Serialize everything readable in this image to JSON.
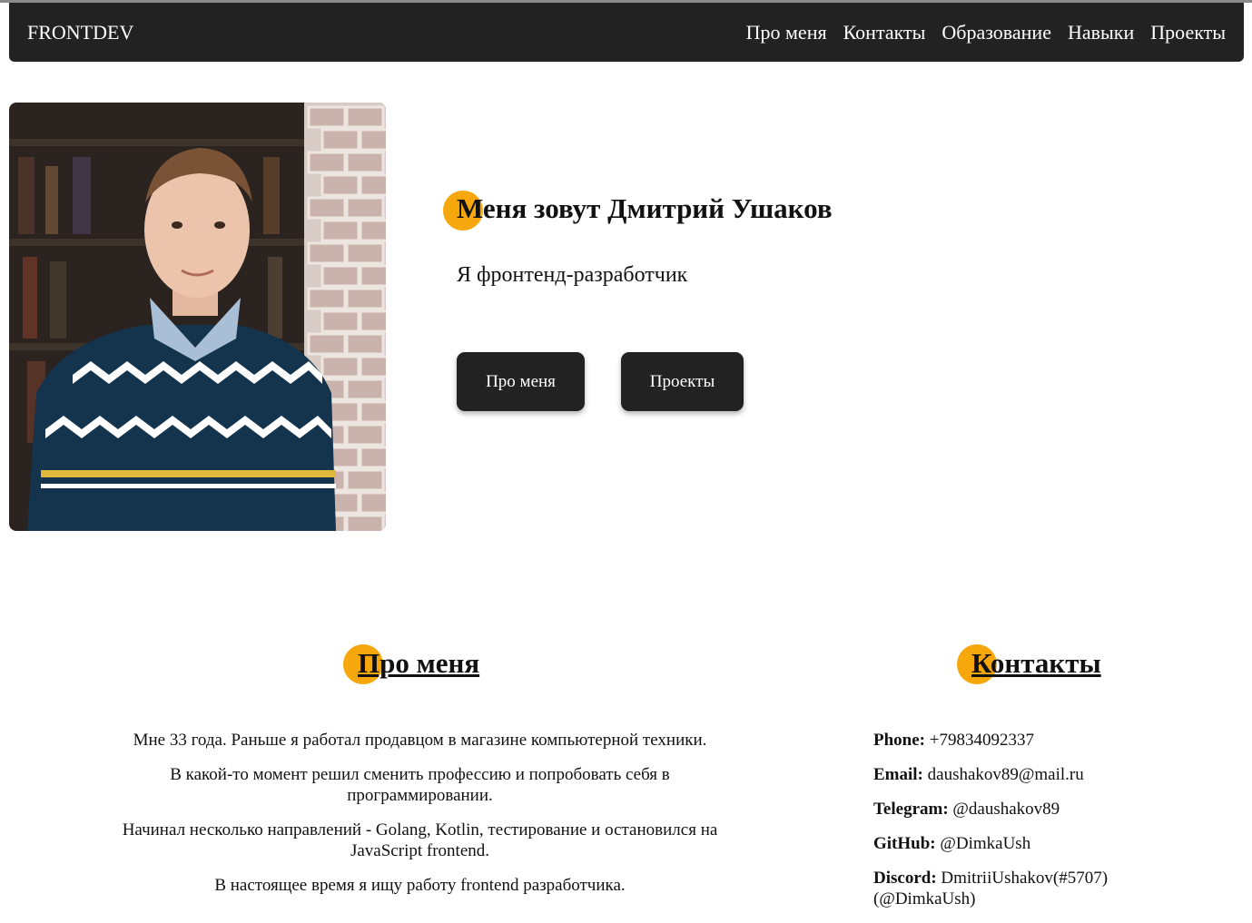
{
  "nav": {
    "brand": "FRONTDEV",
    "links": [
      "Про меня",
      "Контакты",
      "Образование",
      "Навыки",
      "Проекты"
    ]
  },
  "hero": {
    "title": "Меня зовут Дмитрий Ушаков",
    "subtitle": "Я фронтенд-разработчик",
    "buttons": [
      "Про меня",
      "Проекты"
    ]
  },
  "about": {
    "title": "Про меня",
    "paragraphs": [
      "Мне 33 года. Раньше я работал продавцом в магазине компьютерной техники.",
      "В какой-то момент решил сменить профессию и попробовать себя в программировании.",
      "Начинал несколько направлений - Golang, Kotlin, тестирование и остановился на JavaScript frontend.",
      "В настоящее время я ищу работу frontend разработчика."
    ]
  },
  "contacts": {
    "title": "Контакты",
    "items": [
      {
        "label": "Phone:",
        "value": "+79834092337"
      },
      {
        "label": "Email:",
        "value": "daushakov89@mail.ru"
      },
      {
        "label": "Telegram:",
        "value": "@daushakov89"
      },
      {
        "label": "GitHub:",
        "value": "@DimkaUsh"
      },
      {
        "label": "Discord:",
        "value": "DmitriiUshakov(#5707) (@DimkaUsh)"
      }
    ]
  },
  "colors": {
    "navbar": "#222222",
    "accent_dot": "#f5a70c",
    "button": "#222222"
  }
}
